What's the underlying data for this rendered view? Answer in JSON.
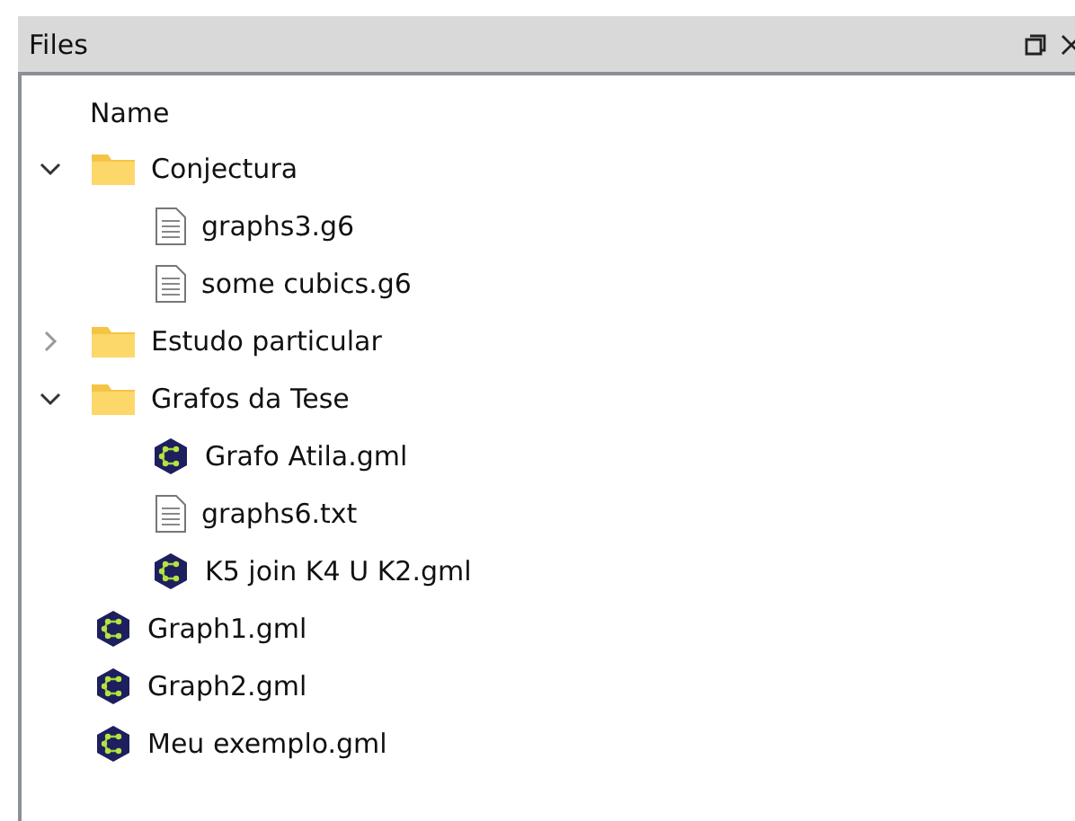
{
  "panel": {
    "title": "Files"
  },
  "column": {
    "label": "Name"
  },
  "tree": [
    {
      "kind": "folder",
      "label": "Conjectura",
      "expanded": true,
      "children": [
        {
          "kind": "text",
          "label": "graphs3.g6"
        },
        {
          "kind": "text",
          "label": "some cubics.g6"
        }
      ]
    },
    {
      "kind": "folder",
      "label": "Estudo particular",
      "expanded": false
    },
    {
      "kind": "folder",
      "label": "Grafos da Tese",
      "expanded": true,
      "children": [
        {
          "kind": "graph",
          "label": "Grafo Atila.gml"
        },
        {
          "kind": "text",
          "label": "graphs6.txt"
        },
        {
          "kind": "graph",
          "label": "K5 join K4 U K2.gml"
        }
      ]
    },
    {
      "kind": "graph",
      "label": "Graph1.gml"
    },
    {
      "kind": "graph",
      "label": "Graph2.gml"
    },
    {
      "kind": "graph",
      "label": "Meu exemplo.gml"
    }
  ]
}
